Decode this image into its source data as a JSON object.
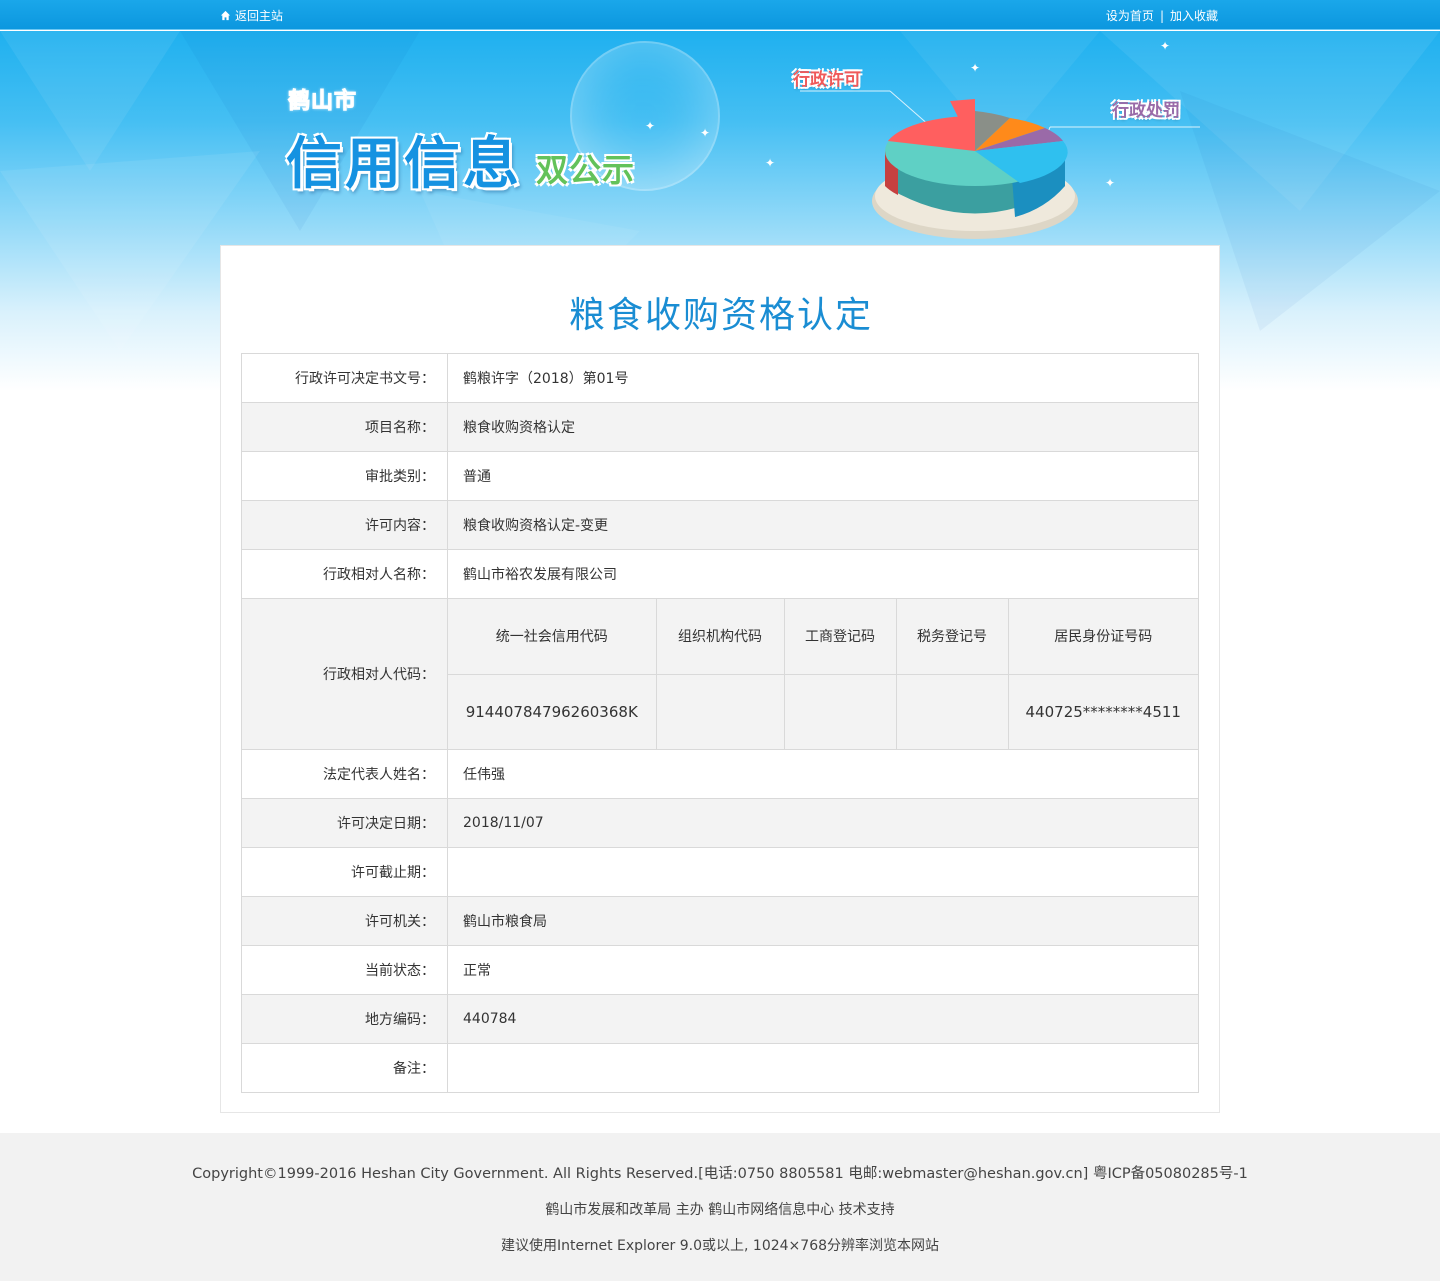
{
  "topbar": {
    "back_label": "返回主站",
    "set_home_label": "设为首页",
    "separator": "|",
    "bookmark_label": "加入收藏"
  },
  "banner": {
    "city": "鹤山市",
    "title": "信用信息",
    "subtitle": "双公示",
    "label_permit": "行政许可",
    "label_penalty": "行政处罚"
  },
  "page_title": "粮食收购资格认定",
  "rows": [
    {
      "label": "行政许可决定书文号：",
      "value": "鹤粮许字（2018）第01号"
    },
    {
      "label": "项目名称：",
      "value": "粮食收购资格认定"
    },
    {
      "label": "审批类别：",
      "value": "普通"
    },
    {
      "label": "许可内容：",
      "value": "粮食收购资格认定-变更"
    },
    {
      "label": "行政相对人名称：",
      "value": "鹤山市裕农发展有限公司"
    }
  ],
  "codes": {
    "label": "行政相对人代码：",
    "headers": [
      "统一社会信用代码",
      "组织机构代码",
      "工商登记码",
      "税务登记号",
      "居民身份证号码"
    ],
    "values": [
      "91440784796260368K",
      "",
      "",
      "",
      "440725********4511"
    ]
  },
  "rows2": [
    {
      "label": "法定代表人姓名：",
      "value": "任伟强"
    },
    {
      "label": "许可决定日期：",
      "value": "2018/11/07"
    },
    {
      "label": "许可截止期：",
      "value": ""
    },
    {
      "label": "许可机关：",
      "value": "鹤山市粮食局"
    },
    {
      "label": "当前状态：",
      "value": "正常"
    },
    {
      "label": "地方编码：",
      "value": "440784"
    },
    {
      "label": "备注：",
      "value": ""
    }
  ],
  "footer": {
    "line1": "Copyright©1999-2016 Heshan City Government. All Rights Reserved.[电话:0750 8805581 电邮:webmaster@heshan.gov.cn] 粤ICP备05080285号-1",
    "line2": "鹤山市发展和改革局 主办 鹤山市网络信息中心 技术支持",
    "line3": "建议使用Internet Explorer 9.0或以上, 1024×768分辨率浏览本网站"
  },
  "colors": {
    "topbar": "#0c97df",
    "title": "#1a8dd3",
    "row_alt": "#f3f3f3",
    "footer_bg": "#f2f2f2"
  },
  "icons": [
    "home-icon",
    "pie-chart-graphic"
  ]
}
